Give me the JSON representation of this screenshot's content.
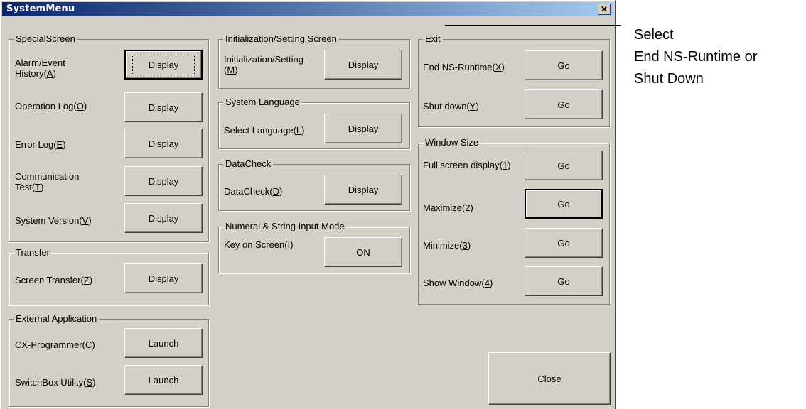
{
  "window": {
    "title": "SystemMenu",
    "close_glyph": "✕"
  },
  "special_screen": {
    "legend": "SpecialScreen",
    "rows": [
      {
        "pre": "Alarm/Event\nHistory(",
        "key": "A",
        "post": ")",
        "button": "Display"
      },
      {
        "pre": "Operation Log(",
        "key": "O",
        "post": ")",
        "button": "Display"
      },
      {
        "pre": "Error Log(",
        "key": "E",
        "post": ")",
        "button": "Display"
      },
      {
        "pre": "Communication\nTest(",
        "key": "T",
        "post": ")",
        "button": "Display"
      },
      {
        "pre": "System Version(",
        "key": "V",
        "post": ")",
        "button": "Display"
      }
    ]
  },
  "transfer": {
    "legend": "Transfer",
    "rows": [
      {
        "pre": "Screen Transfer(",
        "key": "Z",
        "post": ")",
        "button": "Display"
      }
    ]
  },
  "external_application": {
    "legend": "External Application",
    "rows": [
      {
        "pre": "CX-Programmer(",
        "key": "C",
        "post": ")",
        "button": "Launch"
      },
      {
        "pre": "SwitchBox Utility(",
        "key": "S",
        "post": ")",
        "button": "Launch"
      }
    ]
  },
  "initialization": {
    "legend": "Initialization/Setting Screen",
    "rows": [
      {
        "pre": "Initialization/Setting\n(",
        "key": "M",
        "post": ")",
        "button": "Display"
      }
    ]
  },
  "system_language": {
    "legend": "System Language",
    "rows": [
      {
        "pre": "Select Language(",
        "key": "L",
        "post": ")",
        "button": "Display"
      }
    ]
  },
  "datacheck": {
    "legend": "DataCheck",
    "rows": [
      {
        "pre": "DataCheck(",
        "key": "D",
        "post": ")",
        "button": "Display"
      }
    ]
  },
  "input_mode": {
    "legend": "Numeral & String Input Mode",
    "rows": [
      {
        "pre": "Key on Screen(",
        "key": "I",
        "post": ")",
        "button": "ON"
      }
    ]
  },
  "exit": {
    "legend": "Exit",
    "rows": [
      {
        "pre": "End NS-Runtime(",
        "key": "X",
        "post": ")",
        "button": "Go"
      },
      {
        "pre": "Shut down(",
        "key": "Y",
        "post": ")",
        "button": "Go"
      }
    ]
  },
  "window_size": {
    "legend": "Window Size",
    "rows": [
      {
        "pre": "Full screen display(",
        "key": "1",
        "post": ")",
        "button": "Go"
      },
      {
        "pre": "Maximize(",
        "key": "2",
        "post": ")",
        "button": "Go"
      },
      {
        "pre": "Minimize(",
        "key": "3",
        "post": ")",
        "button": "Go"
      },
      {
        "pre": "Show Window(",
        "key": "4",
        "post": ")",
        "button": "Go"
      }
    ]
  },
  "close_button": "Close",
  "annotation": {
    "line1": "Select",
    "line2": "End NS-Runtime or",
    "line3": "Shut Down"
  },
  "colors": {
    "titlebar_start": "#0a246a",
    "titlebar_end": "#a6caf0",
    "face": "#d4d0c8"
  }
}
